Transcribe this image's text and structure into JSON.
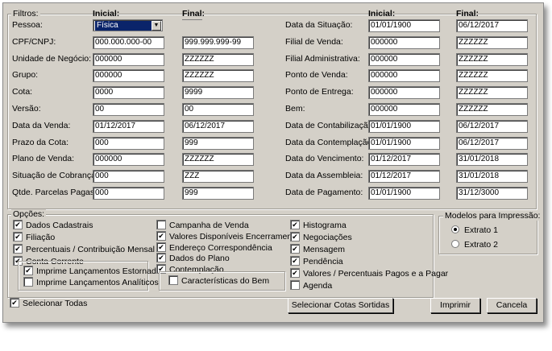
{
  "filters": {
    "legend": "Filtros:",
    "initial_header": "Inicial:",
    "final_header": "Final:",
    "left": [
      {
        "label": "Pessoa:",
        "initial": "Física",
        "final": ""
      },
      {
        "label": "CPF/CNPJ:",
        "initial": "000.000.000-00",
        "final": "999.999.999-99"
      },
      {
        "label": "Unidade de Negócio:",
        "initial": "000000",
        "final": "ZZZZZZ"
      },
      {
        "label": "Grupo:",
        "initial": "000000",
        "final": "ZZZZZZ"
      },
      {
        "label": "Cota:",
        "initial": "0000",
        "final": "9999"
      },
      {
        "label": "Versão:",
        "initial": "00",
        "final": "00"
      },
      {
        "label": "Data da Venda:",
        "initial": "01/12/2017",
        "final": "06/12/2017"
      },
      {
        "label": "Prazo da Cota:",
        "initial": "000",
        "final": "999"
      },
      {
        "label": "Plano de Venda:",
        "initial": "000000",
        "final": "ZZZZZZ"
      },
      {
        "label": "Situação de Cobrança:",
        "initial": "000",
        "final": "ZZZ"
      },
      {
        "label": "Qtde. Parcelas Pagas:",
        "initial": "000",
        "final": "999"
      }
    ],
    "right": [
      {
        "label": "Data da Situação:",
        "initial": "01/01/1900",
        "final": "06/12/2017"
      },
      {
        "label": "Filial de Venda:",
        "initial": "000000",
        "final": "ZZZZZZ"
      },
      {
        "label": "Filial Administrativa:",
        "initial": "000000",
        "final": "ZZZZZZ"
      },
      {
        "label": "Ponto de Venda:",
        "initial": "000000",
        "final": "ZZZZZZ"
      },
      {
        "label": "Ponto de Entrega:",
        "initial": "000000",
        "final": "ZZZZZZ"
      },
      {
        "label": "Bem:",
        "initial": "000000",
        "final": "ZZZZZZ"
      },
      {
        "label": "Data de Contabilização:",
        "initial": "01/01/1900",
        "final": "06/12/2017"
      },
      {
        "label": "Data da Contemplação:",
        "initial": "01/01/1900",
        "final": "06/12/2017"
      },
      {
        "label": "Data do Vencimento:",
        "initial": "01/12/2017",
        "final": "31/01/2018"
      },
      {
        "label": "Data da Assembleia:",
        "initial": "01/12/2017",
        "final": "31/01/2018"
      },
      {
        "label": "Data de Pagamento:",
        "initial": "01/01/1900",
        "final": "31/12/3000"
      }
    ]
  },
  "options": {
    "legend": "Opções:",
    "col1": [
      {
        "label": "Dados Cadastrais",
        "checked": true
      },
      {
        "label": "Filiação",
        "checked": true
      },
      {
        "label": "Percentuais / Contribuição Mensal",
        "checked": true
      },
      {
        "label": "Conta Corrente",
        "checked": true
      }
    ],
    "conta_corrente_sub": [
      {
        "label": "Imprime Lançamentos Estornados",
        "checked": true
      },
      {
        "label": "Imprime Lançamentos Analíticos",
        "checked": false
      }
    ],
    "col2": [
      {
        "label": "Campanha de Venda",
        "checked": false
      },
      {
        "label": "Valores Disponíveis Encerramento",
        "checked": true
      },
      {
        "label": "Endereço Correspondência",
        "checked": true
      },
      {
        "label": "Dados do Plano",
        "checked": true
      },
      {
        "label": "Contemplação",
        "checked": true
      }
    ],
    "contemplacao_sub": [
      {
        "label": "Características do Bem",
        "checked": false
      }
    ],
    "col3": [
      {
        "label": "Histograma",
        "checked": true
      },
      {
        "label": "Negociações",
        "checked": true
      },
      {
        "label": "Mensagem",
        "checked": true
      },
      {
        "label": "Pendência",
        "checked": true
      },
      {
        "label": "Valores / Percentuais Pagos e a Pagar",
        "checked": true
      },
      {
        "label": "Agenda",
        "checked": false
      }
    ]
  },
  "models": {
    "legend": "Modelos para Impressão:",
    "items": [
      {
        "label": "Extrato 1",
        "selected": true
      },
      {
        "label": "Extrato 2",
        "selected": false
      }
    ]
  },
  "footer": {
    "select_all_label": "Selecionar Todas",
    "select_all_checked": true,
    "select_sorted_button": "Selecionar Cotas Sortidas",
    "print_button": "Imprimir",
    "cancel_button": "Cancela"
  }
}
